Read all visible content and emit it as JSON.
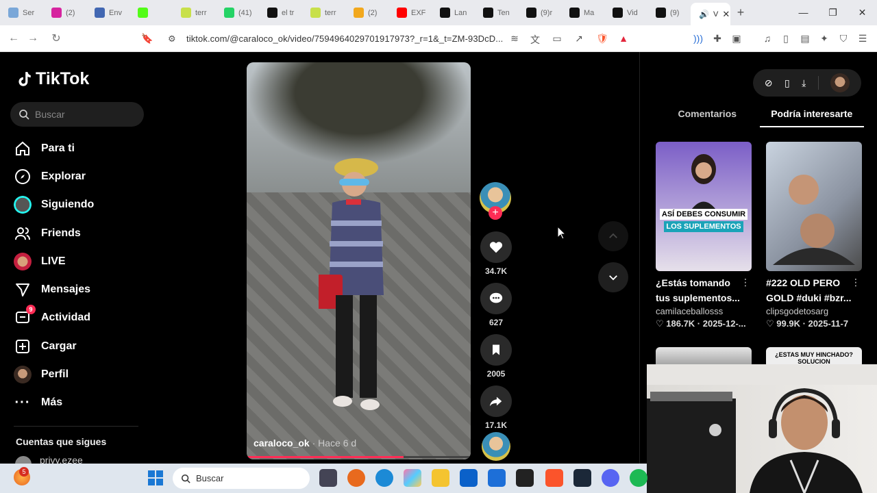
{
  "browser": {
    "tabs": [
      {
        "label": "Ser",
        "color": "#7aa7d8"
      },
      {
        "label": "(2)",
        "color": "#d6249f"
      },
      {
        "label": "Env",
        "color": "#4267b2"
      },
      {
        "label": "",
        "color": "#53fc18"
      },
      {
        "label": "terr",
        "color": "#c8e04a"
      },
      {
        "label": "(41)",
        "color": "#25d366"
      },
      {
        "label": "el tr",
        "color": "#111111"
      },
      {
        "label": "terr",
        "color": "#c8e04a"
      },
      {
        "label": "(2)",
        "color": "#f2a81d"
      },
      {
        "label": "EXF",
        "color": "#ff0000"
      },
      {
        "label": "Lan",
        "color": "#111111"
      },
      {
        "label": "Ten",
        "color": "#111111"
      },
      {
        "label": "(9)r",
        "color": "#111111"
      },
      {
        "label": "Ma",
        "color": "#111111"
      },
      {
        "label": "Vid",
        "color": "#111111"
      },
      {
        "label": "(9)",
        "color": "#111111"
      }
    ],
    "active_tab": {
      "label": "V"
    },
    "url": "tiktok.com/@caraloco_ok/video/7594964029701917973?_r=1&_t=ZM-93DcD..."
  },
  "tiktok": {
    "logo": "TikTok",
    "search_placeholder": "Buscar",
    "nav": [
      {
        "label": "Para ti",
        "icon": "home-icon"
      },
      {
        "label": "Explorar",
        "icon": "compass-icon"
      },
      {
        "label": "Siguiendo",
        "icon": "avatar"
      },
      {
        "label": "Friends",
        "icon": "friends-icon"
      },
      {
        "label": "LIVE",
        "icon": "live-icon"
      },
      {
        "label": "Mensajes",
        "icon": "send-icon"
      },
      {
        "label": "Actividad",
        "icon": "inbox-icon",
        "badge": "9"
      },
      {
        "label": "Cargar",
        "icon": "upload-icon"
      },
      {
        "label": "Perfil",
        "icon": "avatar"
      },
      {
        "label": "Más",
        "icon": "more-icon"
      }
    ],
    "following_title": "Cuentas que sigues",
    "following_user": "privy.ezee"
  },
  "video": {
    "author": "caraloco_ok",
    "time": " · Hace 6 d",
    "progress": 0.7,
    "likes": "34.7K",
    "comments": "627",
    "saves": "2005",
    "shares": "17.1K"
  },
  "panel": {
    "tabs": [
      "Comentarios",
      "Podría interesarte"
    ],
    "active_tab": 1,
    "cards": [
      {
        "title": "¿Estás tomando tus suplementos...",
        "author": "camilaceballosss",
        "stats": "♡ 186.7K · 2025-12-...",
        "overlay1": "ASÍ DEBES CONSUMIR",
        "overlay2": "LOS SUPLEMENTOS"
      },
      {
        "title": "#222 OLD PERO GOLD #duki #bzr...",
        "author": "clipsgodetosarg",
        "stats": "♡ 99.9K · 2025-11-7"
      },
      {
        "title": "",
        "author": "",
        "stats": ""
      },
      {
        "title": "",
        "author": "",
        "stats": "",
        "overlay1": "¿ESTAS MUY HINCHADO? SOLUCION"
      }
    ]
  },
  "taskbar": {
    "search_placeholder": "Buscar",
    "notification_badge": "5"
  },
  "colors": {
    "accent": "#fe2c55",
    "teal": "#25f4ee"
  }
}
